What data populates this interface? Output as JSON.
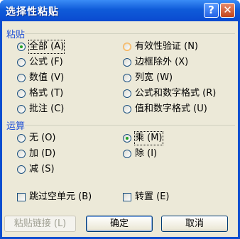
{
  "title": "选择性粘贴",
  "help_glyph": "?",
  "close_glyph": "✕",
  "paste_group": {
    "label": "粘贴",
    "left": [
      "全部 (A)",
      "公式 (F)",
      "数值 (V)",
      "格式 (T)",
      "批注 (C)"
    ],
    "right": [
      "有效性验证 (N)",
      "边框除外 (X)",
      "列宽 (W)",
      "公式和数字格式 (R)",
      "值和数字格式 (U)"
    ],
    "selected": "全部 (A)"
  },
  "operation_group": {
    "label": "运算",
    "left": [
      "无 (O)",
      "加 (D)",
      "减 (S)"
    ],
    "right": [
      "乘 (M)",
      "除 (I)"
    ],
    "selected": "乘 (M)"
  },
  "checkboxes": {
    "skip_blanks": "跳过空单元 (B)",
    "transpose": "转置 (E)"
  },
  "buttons": {
    "paste_link": "粘贴链接 (L)",
    "ok": "确定",
    "cancel": "取消"
  }
}
